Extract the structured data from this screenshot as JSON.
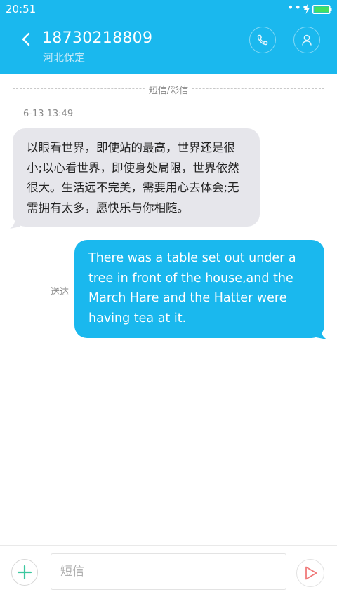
{
  "status_bar": {
    "time": "20:51",
    "dots": "•••"
  },
  "header": {
    "contact_number": "18730218809",
    "contact_location": "河北保定"
  },
  "thread": {
    "type_label": "短信/彩信",
    "timestamp": "6-13 13:49",
    "incoming_message": "以眼看世界，即使站的最高，世界还是很小;以心看世界，即使身处局限，世界依然很大。生活远不完美，需要用心去体会;无需拥有太多，愿快乐与你相随。",
    "outgoing_message": "There was a table set out under a tree in front of the house,and the March Hare and the Hatter were having tea at it.",
    "outgoing_status": "送达"
  },
  "composer": {
    "placeholder": "短信",
    "value": ""
  },
  "colors": {
    "accent": "#1ab8ee",
    "incoming_bubble": "#e6e6eb",
    "attach_icon": "#3cc8a0",
    "send_icon": "#f07a7a"
  },
  "icons": {
    "back": "chevron-left-icon",
    "call": "phone-icon",
    "contact": "person-icon",
    "attach": "plus-icon",
    "send": "send-triangle-icon",
    "charge": "lightning-icon",
    "battery": "battery-icon"
  }
}
